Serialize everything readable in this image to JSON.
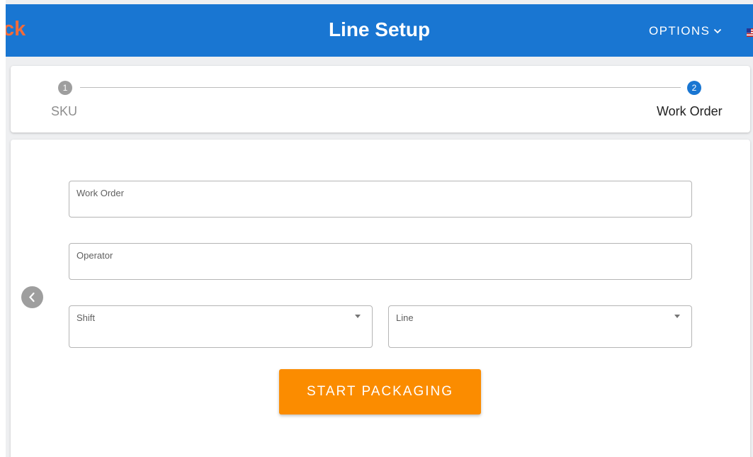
{
  "header": {
    "logo_text": "ck",
    "title": "Line Setup",
    "options_label": "OPTIONS",
    "brand_color": "#1976d2",
    "logo_color": "#f26b3a"
  },
  "stepper": {
    "steps": [
      {
        "number": "1",
        "label": "SKU",
        "state": "completed"
      },
      {
        "number": "2",
        "label": "Work Order",
        "state": "active"
      }
    ]
  },
  "form": {
    "work_order": {
      "label": "Work Order",
      "value": ""
    },
    "operator": {
      "label": "Operator",
      "value": ""
    },
    "shift": {
      "label": "Shift",
      "selected": ""
    },
    "line": {
      "label": "Line",
      "selected": ""
    },
    "submit_label": "START PACKAGING",
    "submit_color": "#fb8c00"
  },
  "icons": {
    "back": "chevron-left-icon",
    "options": "chevron-down-icon",
    "flag": "us-flag-icon",
    "select": "arrow-drop-down-icon"
  }
}
